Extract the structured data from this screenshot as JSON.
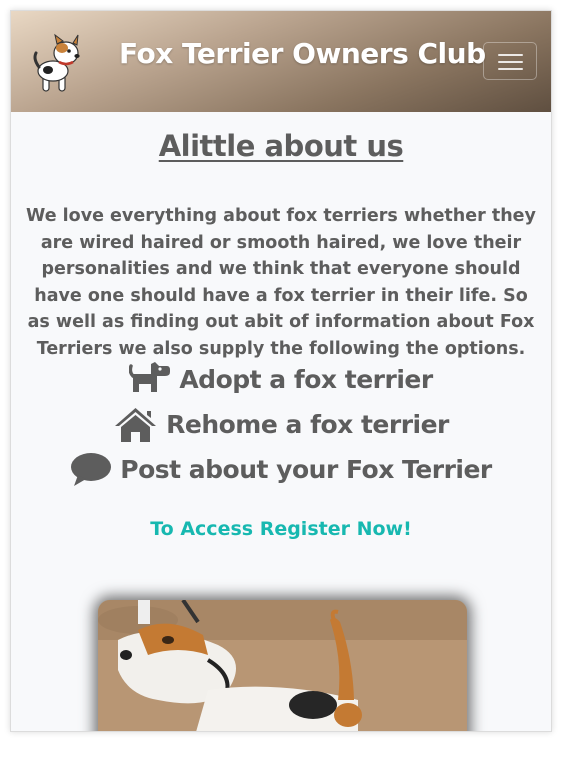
{
  "brand": {
    "title": "Fox Terrier Owners Club",
    "logo_icon": "cartoon-fox-terrier-dog-icon"
  },
  "navbar": {
    "toggler_icon": "hamburger-menu-icon"
  },
  "about": {
    "heading": "Alittle about us",
    "intro": "We love everything about fox terriers whether they are wired haired or smooth haired, we love their personalities and we think that everyone should have one should have a fox terrier in their life. So as well as finding out abit of information about Fox Terriers we also supply the following the options."
  },
  "options": [
    {
      "label": "Adopt a fox terrier",
      "icon": "dog-icon"
    },
    {
      "label": "Rehome a fox terrier",
      "icon": "home-icon"
    },
    {
      "label": "Post about your Fox Terrier",
      "icon": "comment-icon"
    }
  ],
  "cta": {
    "label": "To Access Register Now!"
  },
  "colors": {
    "text": "#5d5d5d",
    "link": "#17b8b0",
    "nav_gradient_light": "#e9d8c4",
    "nav_gradient_dark": "#5f4f40"
  }
}
